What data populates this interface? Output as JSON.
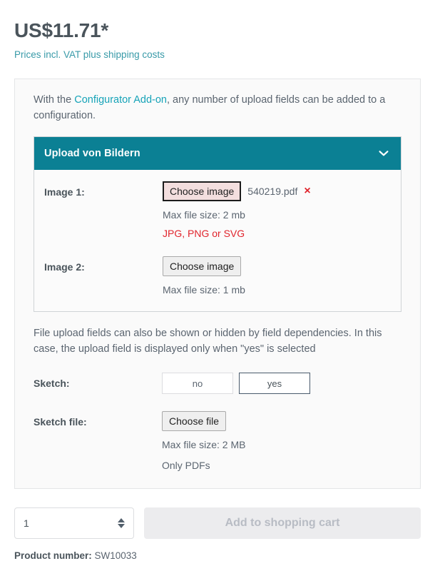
{
  "price": {
    "amount": "US$11.71*",
    "note": "Prices incl. VAT plus shipping costs"
  },
  "panel": {
    "intro_before": "With the ",
    "intro_link": "Configurator Add-on",
    "intro_after": ", any number of upload fields can be added to a configuration."
  },
  "upload_card": {
    "title": "Upload von Bildern",
    "collapse_icon": "chevron-down-icon",
    "fields": [
      {
        "label": "Image 1:",
        "button_label": "Choose image",
        "file_name": "540219.pdf",
        "remove_icon": "×",
        "size_hint": "Max file size: 2 mb",
        "format_hint": "JPG, PNG or SVG",
        "has_error": true
      },
      {
        "label": "Image 2:",
        "button_label": "Choose image",
        "file_name": "",
        "size_hint": "Max file size: 1 mb",
        "format_hint": "",
        "has_error": false
      }
    ]
  },
  "dependency": {
    "text": "File upload fields can also be shown or hidden by field dependencies. In this case, the upload field is displayed only when \"yes\" is selected",
    "sketch_label": "Sketch:",
    "option_no": "no",
    "option_yes": "yes",
    "selected_option": "yes",
    "sketch_file_label": "Sketch file:",
    "sketch_file_button": "Choose file",
    "sketch_size_hint": "Max file size: 2 MB",
    "sketch_format_hint": "Only PDFs"
  },
  "buy": {
    "quantity": "1",
    "stepper_icon": "updown-arrows-icon",
    "cart_button": "Add to shopping cart"
  },
  "footer": {
    "product_number_label": "Product number:",
    "product_number_value": "SW10033"
  },
  "colors": {
    "teal": "#0b8094",
    "link": "#16a3b8",
    "error": "#e0242c",
    "text": "#4a545b"
  }
}
